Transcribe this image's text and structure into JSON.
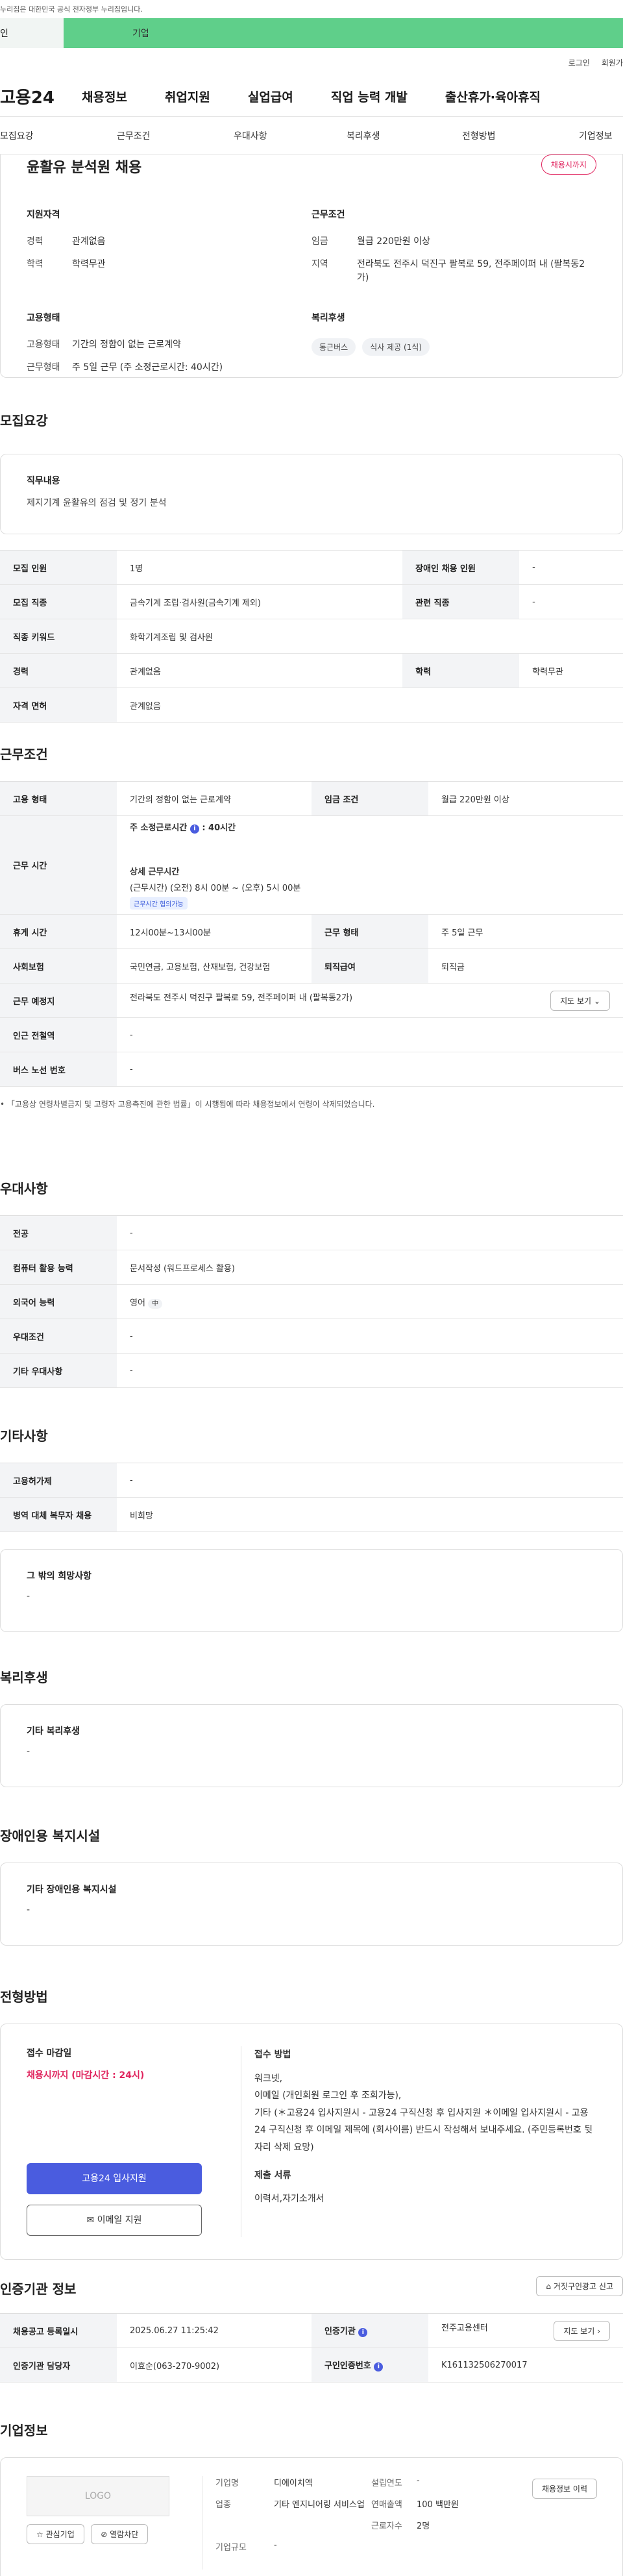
{
  "gov_banner": "누리집은 대한민국 공식 전자정부 누리집입니다.",
  "role_tabs": {
    "person": "인",
    "biz": "기업"
  },
  "util": {
    "login": "로그인",
    "join": "회원가"
  },
  "gnb": {
    "logo": "고용24",
    "items": [
      "채용정보",
      "취업지원",
      "실업급여",
      "직업 능력 개발",
      "출산휴가·육아휴직"
    ]
  },
  "subnav": [
    "모집요강",
    "근무조건",
    "우대사항",
    "복리후생",
    "전형방법",
    "기업정보"
  ],
  "summary": {
    "title": "윤활유 분석원 채용",
    "badge": "채용시까지",
    "qual": {
      "heading": "지원자격",
      "career_k": "경력",
      "career_v": "관계없음",
      "edu_k": "학력",
      "edu_v": "학력무관"
    },
    "cond": {
      "heading": "근무조건",
      "wage_k": "임금",
      "wage_v": "월급 220만원 이상",
      "loc_k": "지역",
      "loc_v": "전라북도 전주시 덕진구 팔복로 59, 전주페이퍼 내 (팔복동2가)"
    },
    "emp": {
      "heading": "고용형태",
      "type_k": "고용형태",
      "type_v": "기간의 정함이 없는 근로계약",
      "form_k": "근무형태",
      "form_v": "주 5일 근무 (주 소정근로시간: 40시간)"
    },
    "welfare": {
      "heading": "복리후생",
      "chips": [
        "통근버스",
        "식사 제공 (1식)"
      ]
    }
  },
  "recruit": {
    "title": "모집요강",
    "duty_h": "직무내용",
    "duty_v": "제지기계 윤활유의 점검 및 정기 분석",
    "rows": [
      {
        "k1": "모집 인원",
        "v1": "1명",
        "k2": "장애인 채용 인원",
        "v2": "-"
      },
      {
        "k1": "모집 직종",
        "v1": "금속기계 조립·검사원(금속기계 제외)",
        "k2": "관련 직종",
        "v2": "-"
      },
      {
        "k1": "직종 키워드",
        "v1": "화학기계조립 및 검사원"
      },
      {
        "k1": "경력",
        "v1": "관계없음",
        "k2": "학력",
        "v2": "학력무관"
      },
      {
        "k1": "자격 면허",
        "v1": "관계없음"
      }
    ]
  },
  "work": {
    "title": "근무조건",
    "type_k": "고용 형태",
    "type_v": "기간의 정함이 없는 근로계약",
    "wage_k": "임금 조건",
    "wage_v": "월급 220만원 이상",
    "hours_k": "근무 시간",
    "hours_week": "주 소정근로시간",
    "hours_week_v": ": 40시간",
    "detail_h": "상세 근무시간",
    "detail_v": "(근무시간) (오전) 8시 00분 ~ (오후) 5시 00분",
    "tag": "근무시간 협의가능",
    "break_k": "휴게 시간",
    "break_v": "12시00분~13시00분",
    "form_k": "근무 형태",
    "form_v": "주 5일 근무",
    "ins_k": "사회보험",
    "ins_v": "국민연금, 고용보험, 산재보험, 건강보험",
    "ret_k": "퇴직급여",
    "ret_v": "퇴직금",
    "place_k": "근무 예정지",
    "place_v": "전라북도 전주시 덕진구 팔복로 59, 전주페이퍼 내 (팔복동2가)",
    "map_btn": "지도 보기",
    "subway_k": "인근 전철역",
    "subway_v": "-",
    "bus_k": "버스 노선 번호",
    "bus_v": "-",
    "note": "「고용상 연령차별금지 및 고령자 고용촉진에 관한 법률」이 시행됨에 따라 채용정보에서 연령이 삭제되었습니다."
  },
  "pref": {
    "title": "우대사항",
    "rows": [
      {
        "k": "전공",
        "v": "-"
      },
      {
        "k": "컴퓨터 활용 능력",
        "v": "문서작성 (워드프로세스 활용)"
      },
      {
        "k": "외국어 능력",
        "v": "영어",
        "tag": "中"
      },
      {
        "k": "우대조건",
        "v": "-"
      },
      {
        "k": "기타 우대사항",
        "v": "-"
      }
    ]
  },
  "etc": {
    "title": "기타사항",
    "rows": [
      {
        "k": "고용허가제",
        "v": "-"
      },
      {
        "k": "병역 대체 복무자 채용",
        "v": "비희망"
      }
    ],
    "wish_h": "그 밖의 희망사항",
    "wish_v": "-"
  },
  "benefit": {
    "title": "복리후생",
    "h": "기타 복리후생",
    "v": "-"
  },
  "disabled": {
    "title": "장애인용 복지시설",
    "h": "기타 장애인용 복지시설",
    "v": "-"
  },
  "screening": {
    "title": "전형방법",
    "deadline_h": "접수 마감일",
    "deadline_v": "채용시까지 (마감시간 : 24시)",
    "apply_btn": "고용24 입사지원",
    "email_btn": "이메일 지원",
    "method_h": "접수 방법",
    "method_v1": "워크넷,",
    "method_v2": "이메일 (개인회원 로그인 후 조회가능),",
    "method_v3": "기타 (＊고용24 입사지원시 - 고용24 구직신청 후 입사지원 ＊이메일 입사지원시 - 고용24 구직신청 후 이메일 제목에 (회사이름) 반드시 작성해서 보내주세요. (주민등록번호 뒷자리 삭제 요망)",
    "docs_h": "제출 서류",
    "docs_v": "이력서,자기소개서"
  },
  "agency": {
    "title": "인증기관 정보",
    "report_btn": "거짓구인광고 신고",
    "reg_k": "채용공고 등록일시",
    "reg_v": "2025.06.27 11:25:42",
    "org_k": "인증기관",
    "org_v": "전주고용센터",
    "map_btn": "지도 보기",
    "staff_k": "인증기관 담당자",
    "staff_v": "이효순(063-270-9002)",
    "id_k": "구인인증번호",
    "id_v": "K161132506270017"
  },
  "company": {
    "title": "기업정보",
    "logo": "LOGO",
    "fav_btn": "관심기업",
    "block_btn": "열람차단",
    "history_btn": "채용정보 이력",
    "name_k": "기업명",
    "name_v": "디에이치엑",
    "found_k": "설립연도",
    "found_v": "-",
    "ind_k": "업종",
    "ind_v": "기타 엔지니어링 서비스업",
    "sales_k": "연매출액",
    "sales_v": "100 백만원",
    "emp_k": "근로자수",
    "emp_v": "2명",
    "size_k": "기업규모",
    "size_v": "-"
  },
  "colors": {
    "accent": "#4a5cdf",
    "green": "#5fcf8a",
    "red": "#e0245e"
  }
}
